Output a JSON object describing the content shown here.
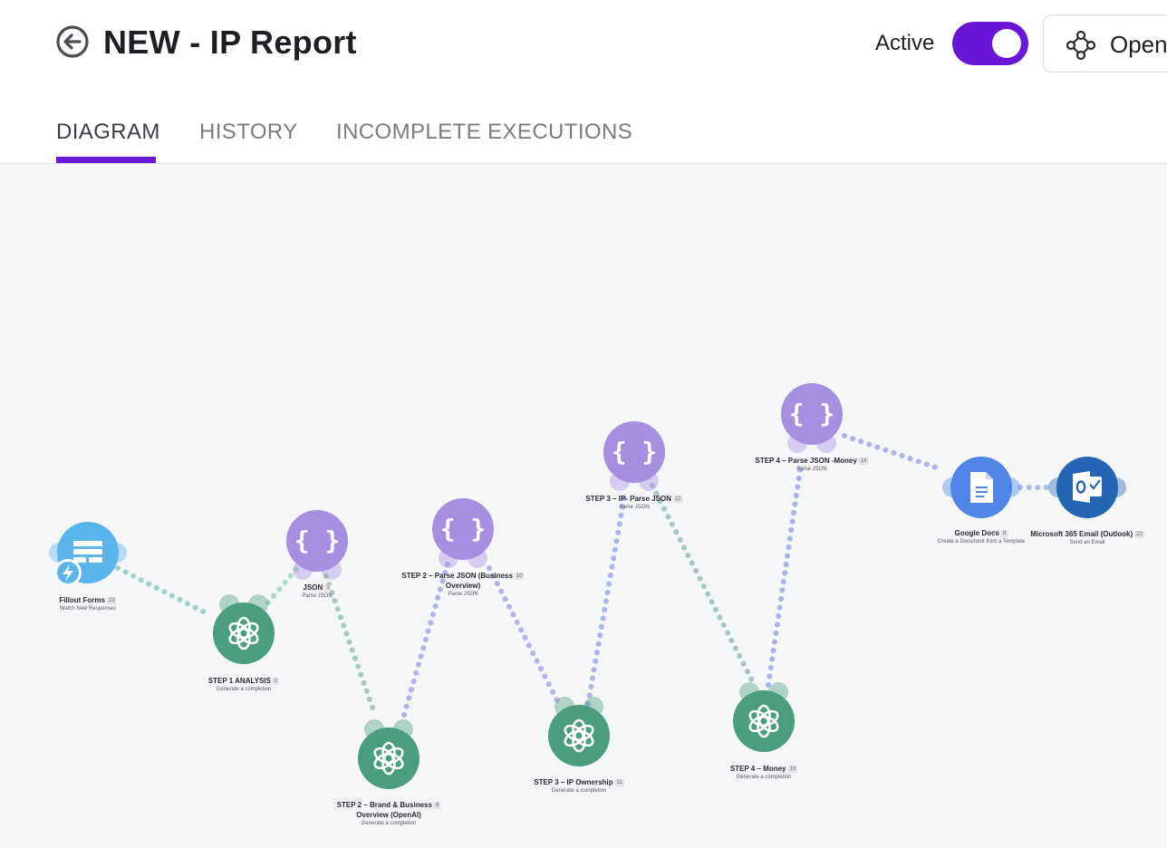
{
  "header": {
    "title": "NEW - IP Report",
    "active_label": "Active",
    "active_on": true,
    "open_label": "Open"
  },
  "tabs": [
    {
      "label": "DIAGRAM",
      "active": true
    },
    {
      "label": "HISTORY",
      "active": false
    },
    {
      "label": "INCOMPLETE EXECUTIONS",
      "active": false
    }
  ],
  "colors": {
    "accent": "#6a16d6",
    "fillout": "#5bb4ec",
    "openai": "#4a9e7e",
    "json": "#a68fe0",
    "google_docs": "#4f86e8",
    "outlook": "#2466b4"
  },
  "nodes": [
    {
      "id": "fillout",
      "icon": "fillout-forms-icon",
      "name": "Fillout Forms",
      "count": "23",
      "subtitle": "Watch New Responses"
    },
    {
      "id": "step1",
      "icon": "openai-icon",
      "name": "STEP 1 ANALYSIS",
      "count": "2",
      "subtitle": "Generate a completion"
    },
    {
      "id": "json3",
      "icon": "json-icon",
      "name": "JSON",
      "count": "3",
      "subtitle": "Parse JSON"
    },
    {
      "id": "step2brand",
      "icon": "openai-icon",
      "name": "STEP 2 – Brand & Business",
      "name2": "Overview (OpenAI)",
      "count": "9",
      "subtitle": "Generate a completion"
    },
    {
      "id": "step2json",
      "icon": "json-icon",
      "name": "STEP 2 – Parse JSON (Business",
      "name2": "Overview)",
      "count": "10",
      "subtitle": "Parse JSON"
    },
    {
      "id": "step3ip",
      "icon": "openai-icon",
      "name": "STEP 3 – IP Ownership",
      "count": "11",
      "subtitle": "Generate a completion"
    },
    {
      "id": "step3json",
      "icon": "json-icon",
      "name": "STEP 3 – IP- Parse JSON",
      "count": "12",
      "subtitle": "Parse JSON"
    },
    {
      "id": "step4money",
      "icon": "openai-icon",
      "name": "STEP 4 – Money",
      "count": "13",
      "subtitle": "Generate a completion"
    },
    {
      "id": "step4json",
      "icon": "json-icon",
      "name": "STEP 4 – Parse JSON -Money",
      "count": "14",
      "subtitle": "Parse JSON"
    },
    {
      "id": "gdocs",
      "icon": "google-docs-icon",
      "name": "Google Docs",
      "count": "6",
      "subtitle": "Create a Document from a Template"
    },
    {
      "id": "outlook",
      "icon": "outlook-icon",
      "name": "Microsoft 365 Email (Outlook)",
      "count": "22",
      "subtitle": "Send an Email"
    }
  ]
}
